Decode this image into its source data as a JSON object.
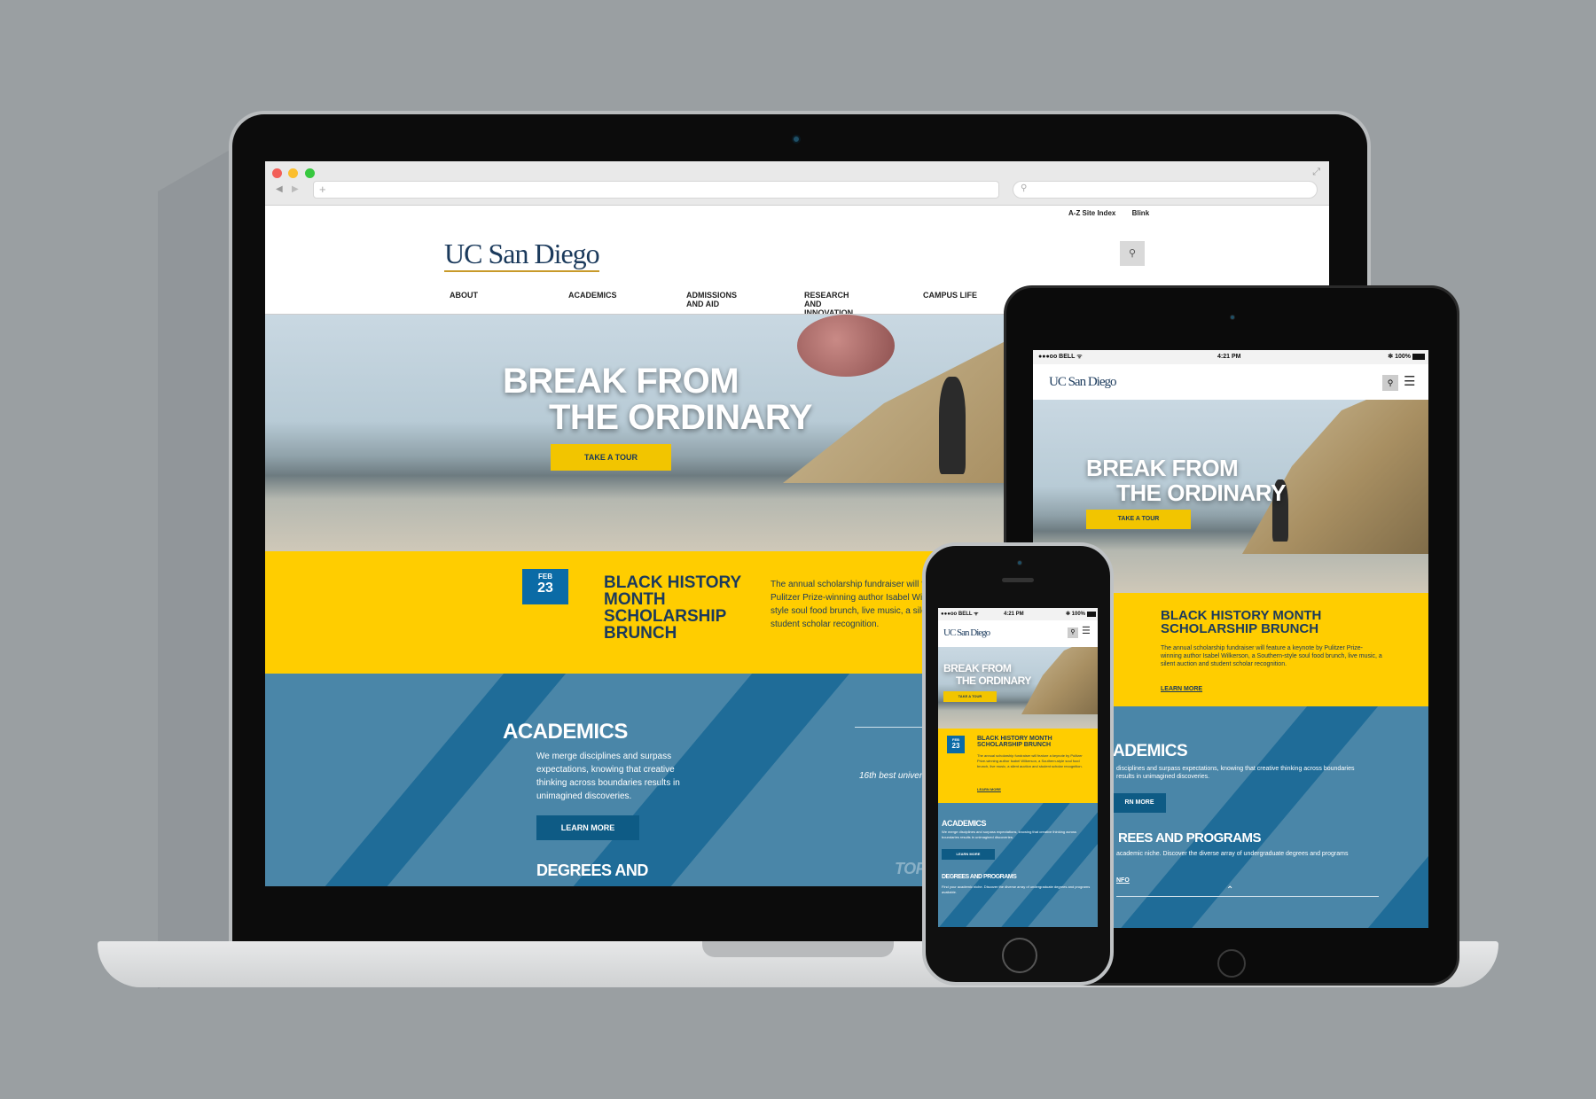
{
  "site": {
    "logo": "UC San Diego",
    "util_links": [
      "A-Z Site Index",
      "Blink"
    ],
    "nav": [
      "ABOUT",
      "ACADEMICS",
      "ADMISSIONS AND AID",
      "RESEARCH AND INNOVATION",
      "CAMPUS LIFE"
    ],
    "hero": {
      "line1": "BREAK FROM",
      "line2": "THE ORDINARY",
      "cta": "TAKE A TOUR"
    },
    "event": {
      "month": "FEB",
      "day": "23",
      "title_desktop_1": "BLACK HISTORY",
      "title_desktop_2": "MONTH",
      "title_desktop_3": "SCHOLARSHIP",
      "title_desktop_4": "BRUNCH",
      "title_1": "BLACK HISTORY MONTH",
      "title_2": "SCHOLARSHIP BRUNCH",
      "desc_desktop_1": "The annual scholarship fundraiser will fe",
      "desc_desktop_2": "Pulitzer Prize-winning author Isabel Wil",
      "desc_desktop_3": "style soul food brunch, live music, a sile",
      "desc_desktop_4": "student scholar recognition.",
      "desc": "The annual scholarship fundraiser will feature a keynote by Pulitzer Prize-winning author Isabel Wilkerson, a Southern-style soul food brunch, live music, a silent auction and student scholar recognition.",
      "learn_more": "LEARN MORE"
    },
    "academics": {
      "title": "ACADEMICS",
      "title_cropped": "ADEMICS",
      "text": "We merge disciplines and surpass expectations, knowing that creative thinking across boundaries results in unimagined discoveries.",
      "text_tablet": "disciplines and surpass expectations, knowing that creative thinking across boundaries results in unimagined discoveries.",
      "learn_more": "LEARN MORE",
      "learn_more_cropped": "RN MORE"
    },
    "degrees": {
      "title": "DEGREES AND PROGRAMS",
      "title_desktop": "DEGREES AND",
      "title_cropped": "REES AND PROGRAMS",
      "text": "Find your academic niche. Discover the diverse array of undergraduate degrees and programs available.",
      "text_tablet": "academic niche. Discover the diverse array of undergraduate degrees and programs",
      "info_cropped": "NFO"
    },
    "ranking": "16th best univers",
    "top_cropped": "TOP"
  },
  "devices": {
    "status_carrier": "●●●oo BELL ᯤ",
    "status_time": "4:21 PM",
    "status_battery": "✻ 100%"
  },
  "colors": {
    "background": "#9a9fa2",
    "navy": "#1b3a5c",
    "yellow": "#ffcd00",
    "blue": "#4a86a8",
    "dark_blue": "#0b6ba6"
  },
  "icons": [
    "search-icon",
    "menu-icon",
    "back-arrow-icon",
    "forward-arrow-icon",
    "plus-icon",
    "expand-icon",
    "chevron-up-icon"
  ]
}
